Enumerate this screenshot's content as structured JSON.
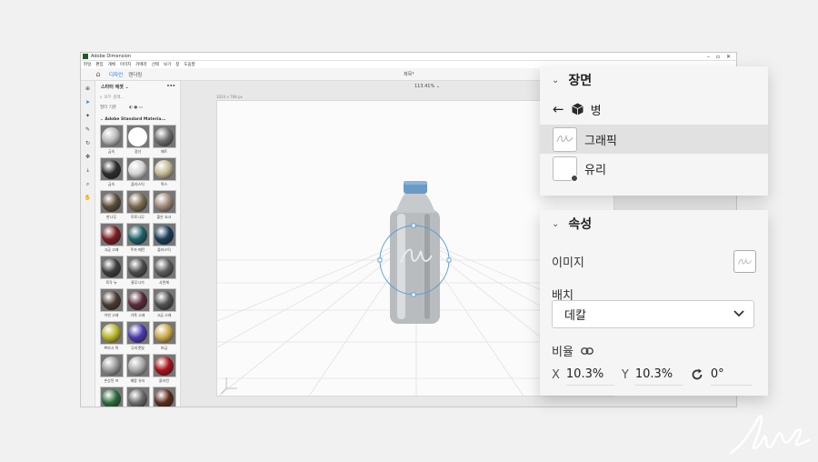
{
  "app": {
    "title": "Adobe Dimension",
    "menu": [
      "파일",
      "편집",
      "개체",
      "이미지",
      "카메라",
      "선택",
      "보기",
      "창",
      "도움말"
    ],
    "mode_tabs": [
      "디자인",
      "렌더링"
    ],
    "document_name": "제목*"
  },
  "canvas": {
    "zoom": "113.41% ⌄",
    "size_label": "1024 x 768 px"
  },
  "library": {
    "title": "스타터 에셋 ⌄",
    "search_placeholder": "모두 검색...",
    "filter_label": "필터 기준",
    "section_title": "Adobe Standard Materia...",
    "materials": [
      {
        "name": "금속",
        "color": "#b9b9b9"
      },
      {
        "name": "광선",
        "color": "#ffffff"
      },
      {
        "name": "매트",
        "color": "#6d6d6d"
      },
      {
        "name": "금속",
        "color": "#2c2c2c"
      },
      {
        "name": "플라스틱",
        "color": "#d4d4d4"
      },
      {
        "name": "왁스",
        "color": "#c2b893"
      },
      {
        "name": "한나무",
        "color": "#5b4c3a"
      },
      {
        "name": "토토나무",
        "color": "#7a6a4e"
      },
      {
        "name": "불은 요크",
        "color": "#a08a7a"
      },
      {
        "name": "고급 고래",
        "color": "#7a1c20"
      },
      {
        "name": "주자 패턴",
        "color": "#1e6068"
      },
      {
        "name": "플라스틱",
        "color": "#173c58"
      },
      {
        "name": "육각 뉴",
        "color": "#3c3c3c"
      },
      {
        "name": "줄무늬가",
        "color": "#4d4d4d"
      },
      {
        "name": "사면체",
        "color": "#5b5b5b"
      },
      {
        "name": "어연 고래",
        "color": "#4a3a32"
      },
      {
        "name": "가죽 고래",
        "color": "#5a2a3a"
      },
      {
        "name": "고급 고래",
        "color": "#505050"
      },
      {
        "name": "쁘라시 빅",
        "color": "#b8b62a"
      },
      {
        "name": "무지갯빛",
        "color": "#4a3ab0"
      },
      {
        "name": "보금",
        "color": "#c9a84a"
      },
      {
        "name": "손상된 프",
        "color": "#9a9a9a"
      },
      {
        "name": "깨뭉 유리",
        "color": "#a9a9a9"
      },
      {
        "name": "붉라린",
        "color": "#a8121a"
      },
      {
        "name": "",
        "color": "#2a6a3a"
      },
      {
        "name": "",
        "color": "#6a6a6a"
      },
      {
        "name": "",
        "color": "#5a2a1a"
      }
    ]
  },
  "scene": {
    "title": "장면",
    "parent": "병",
    "items": [
      {
        "label": "그래픽",
        "selected": true
      },
      {
        "label": "유리",
        "selected": false
      }
    ]
  },
  "properties": {
    "title": "속성",
    "image_label": "이미지",
    "placement_label": "배치",
    "placement_value": "데칼",
    "ratio_label": "비율",
    "x_label": "X",
    "x_value": "10.3%",
    "y_label": "Y",
    "y_value": "10.3%",
    "rotation_value": "0°"
  },
  "watermark": "liis"
}
